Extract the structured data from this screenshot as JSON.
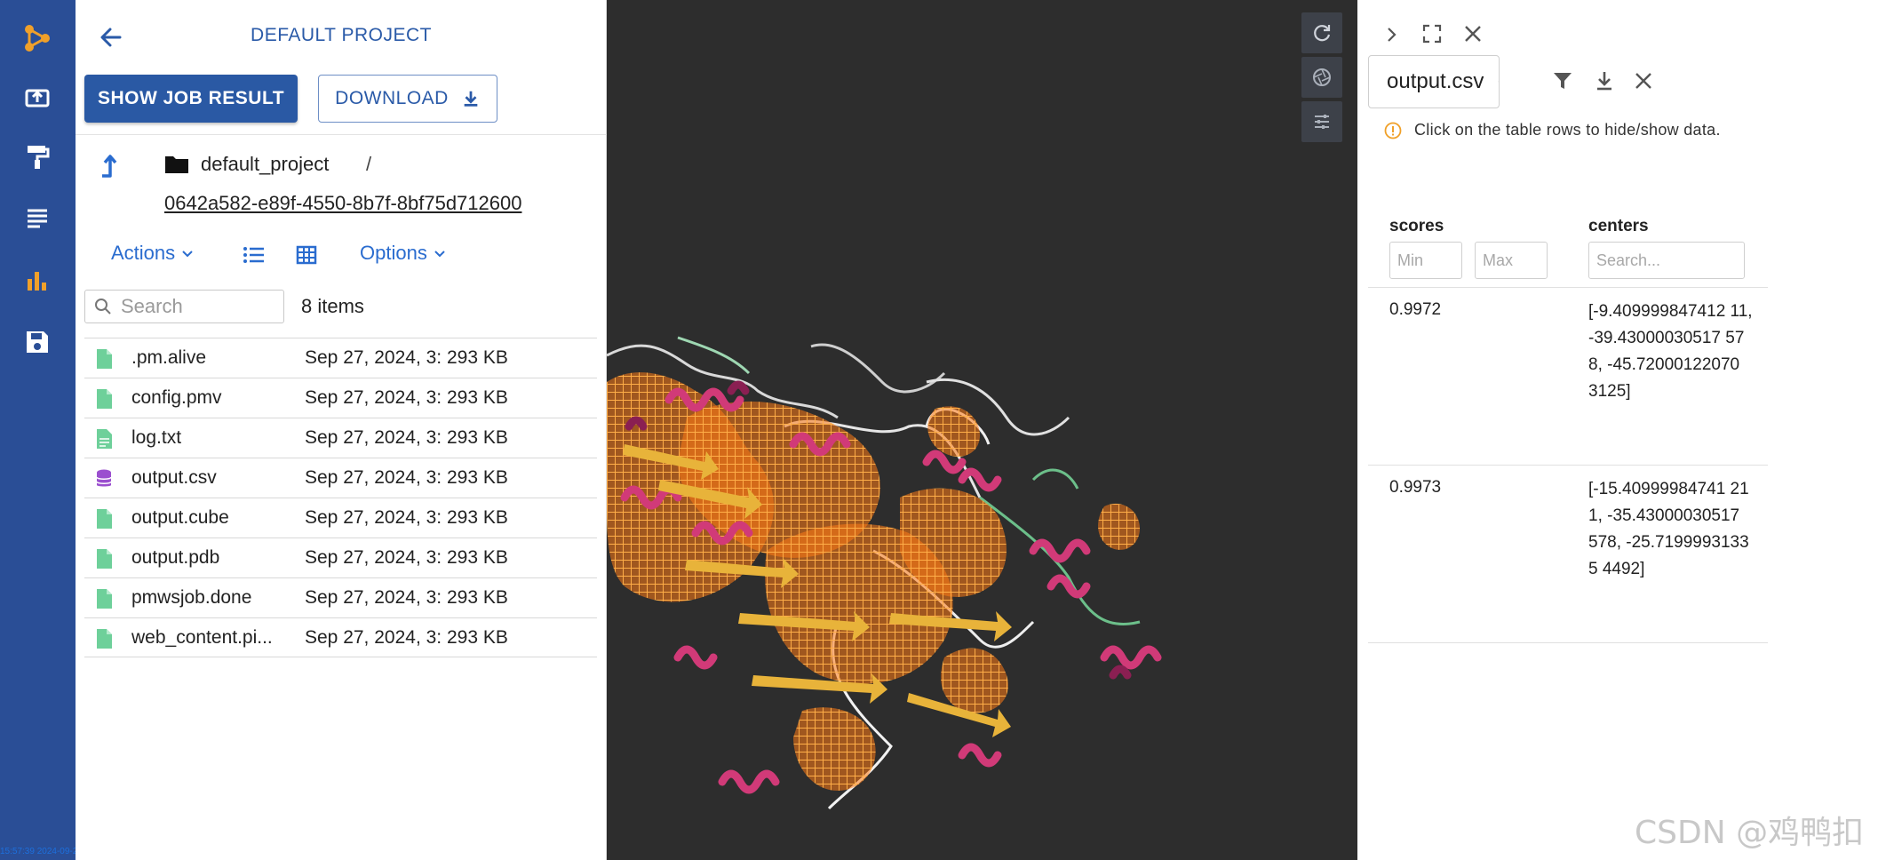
{
  "nav": {
    "items": [
      "logo-icon",
      "upload-icon",
      "paint-roller-icon",
      "menu-lines-icon",
      "bar-chart-icon",
      "save-icon"
    ],
    "clock": "15:57:39 2024-09-27"
  },
  "files": {
    "project_title": "DEFAULT PROJECT",
    "show_job_result": "SHOW JOB RESULT",
    "download": "DOWNLOAD",
    "breadcrumb_root": "default_project",
    "breadcrumb_sep": "/",
    "breadcrumb_job": "0642a582-e89f-4550-8b7f-8bf75d712600",
    "actions_label": "Actions",
    "options_label": "Options",
    "search_placeholder": "Search",
    "item_count": "8 items",
    "rows": [
      {
        "name": ".pm.alive",
        "date": "Sep 27, 2024, 3:",
        "size": "293 KB",
        "icon": "file-icon"
      },
      {
        "name": "config.pmv",
        "date": "Sep 27, 2024, 3:",
        "size": "293 KB",
        "icon": "file-icon"
      },
      {
        "name": "log.txt",
        "date": "Sep 27, 2024, 3:",
        "size": "293 KB",
        "icon": "text-file-icon"
      },
      {
        "name": "output.csv",
        "date": "Sep 27, 2024, 3:",
        "size": "293 KB",
        "icon": "database-icon"
      },
      {
        "name": "output.cube",
        "date": "Sep 27, 2024, 3:",
        "size": "293 KB",
        "icon": "file-icon"
      },
      {
        "name": "output.pdb",
        "date": "Sep 27, 2024, 3:",
        "size": "293 KB",
        "icon": "file-icon"
      },
      {
        "name": "pmwsjob.done",
        "date": "Sep 27, 2024, 3:",
        "size": "293 KB",
        "icon": "file-icon"
      },
      {
        "name": "web_content.pi...",
        "date": "Sep 27, 2024, 3:",
        "size": "293 KB",
        "icon": "file-icon"
      }
    ]
  },
  "viewer": {
    "tools": [
      "reset-rotate-icon",
      "aperture-icon",
      "sliders-icon"
    ]
  },
  "data_panel": {
    "selected_file": "output.csv",
    "notice": "Click on the table rows to hide/show data.",
    "columns": {
      "scores": "scores",
      "centers": "centers"
    },
    "min_placeholder": "Min",
    "max_placeholder": "Max",
    "center_search_placeholder": "Search...",
    "rows": [
      {
        "score": "0.9972",
        "center": "[-9.409999847412 11, -39.43000030517 578, -45.72000122070 3125]"
      },
      {
        "score": "0.9973",
        "center": "[-15.40999984741 211, -35.43000030517 578, -25.71999931335 4492]"
      }
    ]
  },
  "watermark": "CSDN @鸡鸭扣",
  "colors": {
    "nav_bg": "#2a4e96",
    "primary": "#2a59a4",
    "link": "#2a6ccf",
    "viewer_bg": "#2d2d2d",
    "density_mesh": "#ff7a14",
    "helix": "#d13a78",
    "sheet": "#e8b33a",
    "coil": "#e8e8e8"
  }
}
